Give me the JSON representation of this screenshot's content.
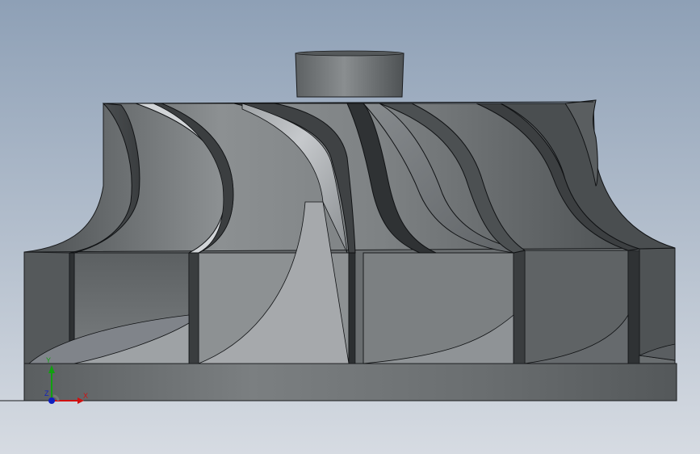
{
  "viewport": {
    "background_top": "#8ea0b6",
    "background_bottom": "#d6dbe2"
  },
  "model": {
    "name": "impeller",
    "blade_count": 8,
    "colors": {
      "base": "#6d7173",
      "hub": "#7b7f82",
      "blade_light": "#c4c7ca",
      "blade_dark": "#3f4244",
      "edge": "#101214"
    }
  },
  "triad": {
    "x_label": "X",
    "y_label": "Y",
    "z_label": "Z",
    "x_color": "#d01010",
    "y_color": "#10a010",
    "z_color": "#1020c0"
  }
}
